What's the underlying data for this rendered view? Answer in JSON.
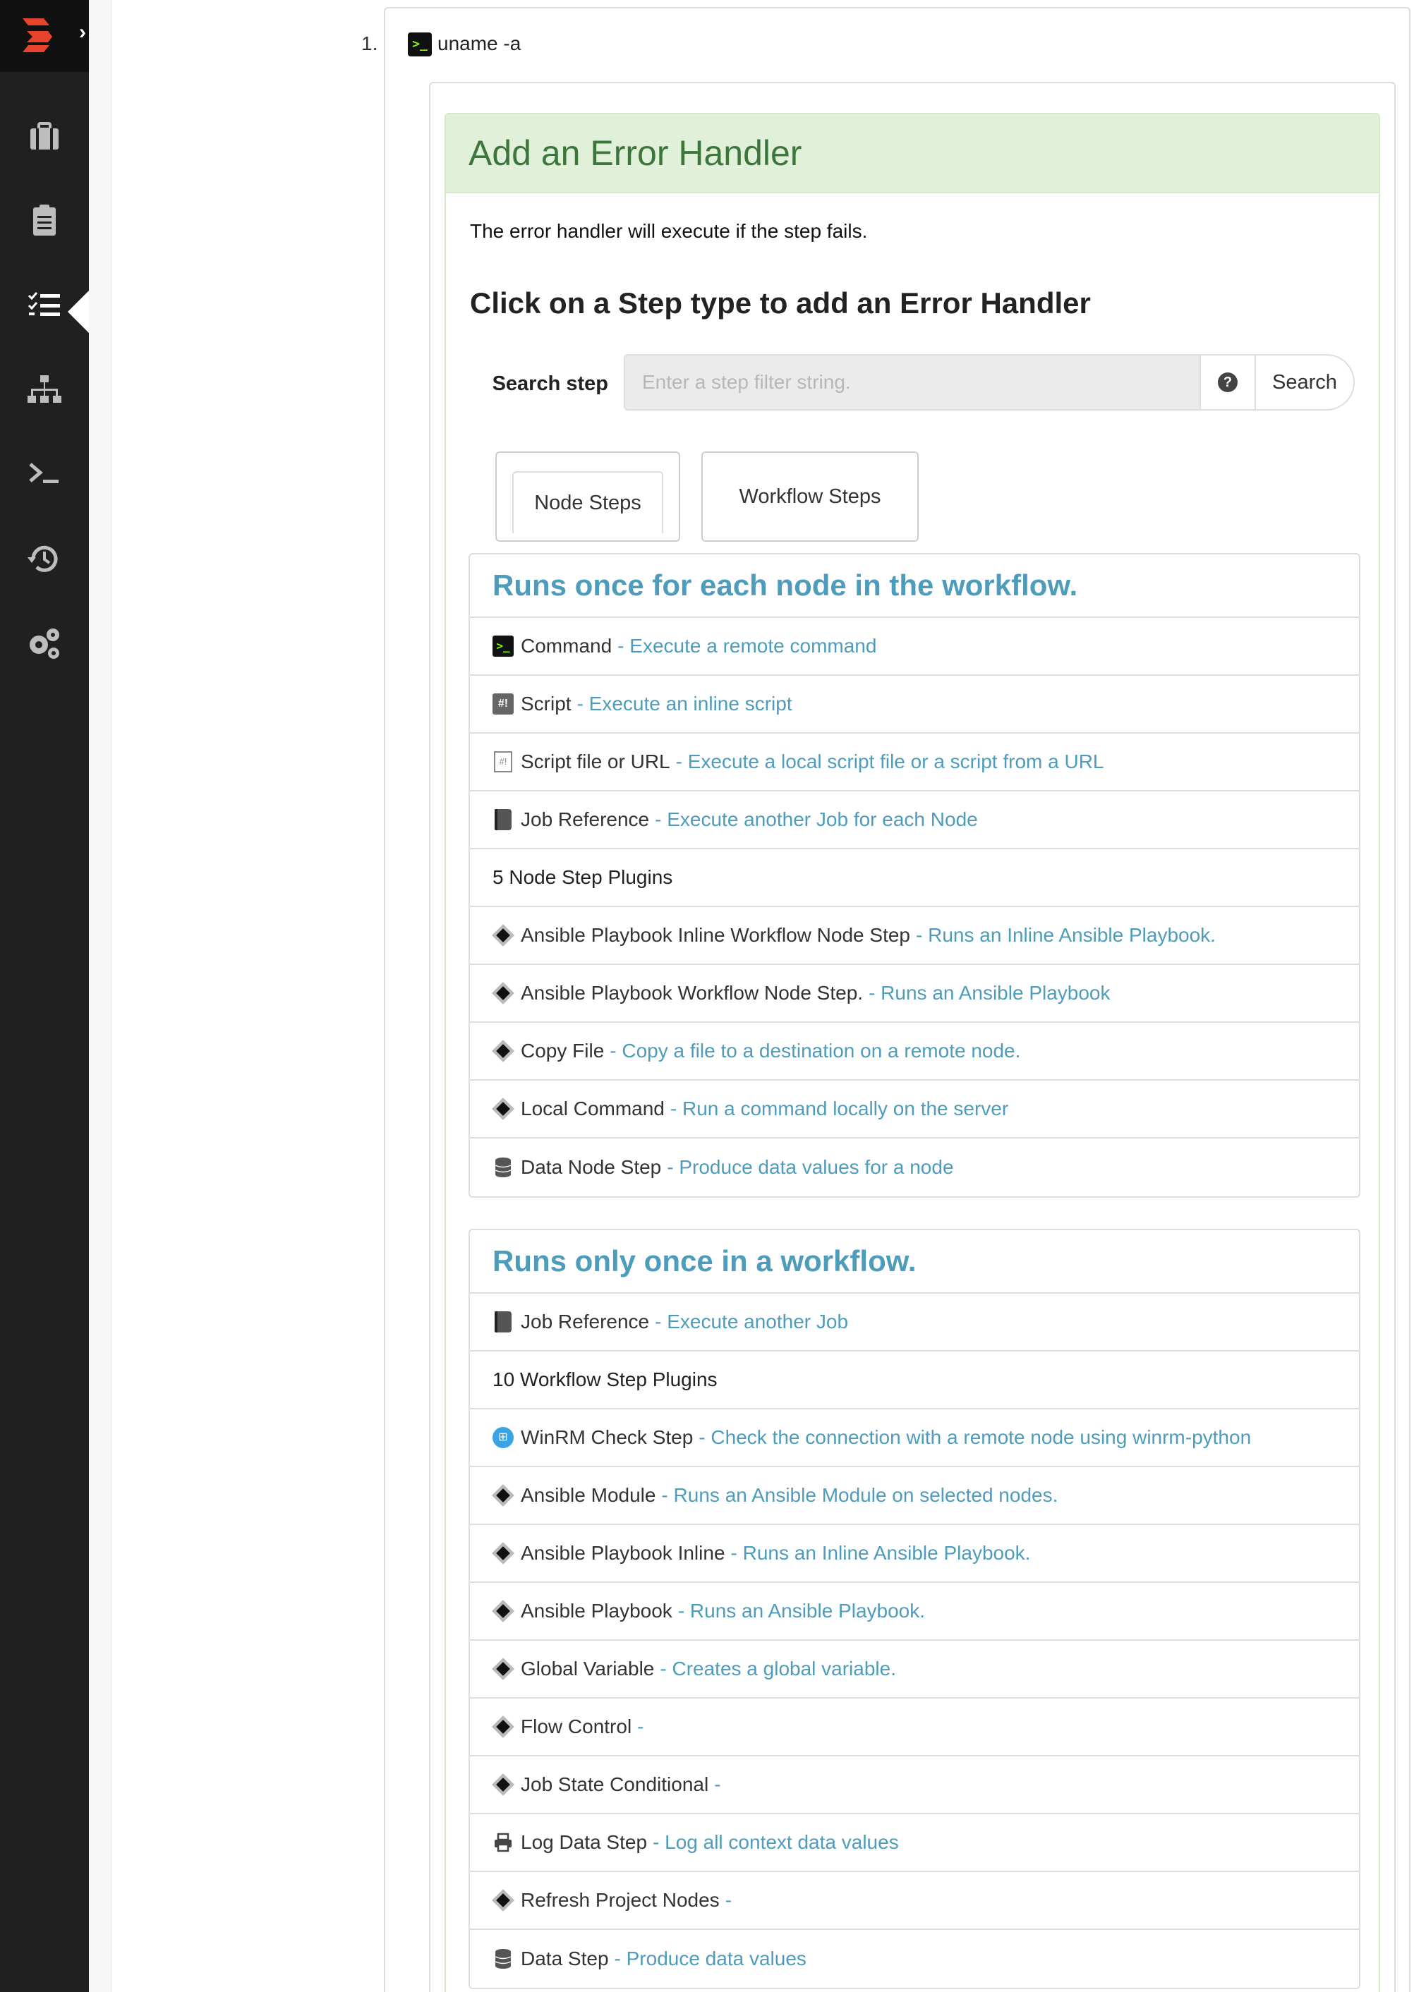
{
  "sidebar": {
    "nav": [
      {
        "icon": "briefcase-icon"
      },
      {
        "icon": "clipboard-list-icon"
      },
      {
        "icon": "tasks-list-icon"
      },
      {
        "icon": "sitemap-icon"
      },
      {
        "icon": "terminal-icon"
      },
      {
        "icon": "history-icon"
      },
      {
        "icon": "gears-icon"
      }
    ],
    "active_index": 2
  },
  "step": {
    "number": "1.",
    "title": "uname -a"
  },
  "panel": {
    "heading": "Add an Error Handler",
    "help": "The error handler will execute if the step fails.",
    "instruction": "Click on a Step type to add an Error Handler"
  },
  "search": {
    "label": "Search step",
    "placeholder": "Enter a step filter string.",
    "button": "Search"
  },
  "tabs": {
    "node": "Node Steps",
    "workflow": "Workflow Steps"
  },
  "node_steps": {
    "heading": "Runs once for each node in the workflow.",
    "items": [
      {
        "icon": "command-icon",
        "name": "Command",
        "desc": "- Execute a remote command"
      },
      {
        "icon": "script-icon",
        "name": "Script",
        "desc": "- Execute an inline script"
      },
      {
        "icon": "script-file-icon",
        "name": "Script file or URL",
        "desc": "- Execute a local script file or a script from a URL"
      },
      {
        "icon": "book-icon",
        "name": "Job Reference",
        "desc": "- Execute another Job for each Node"
      }
    ],
    "plugins_label": "5 Node Step Plugins",
    "plugins": [
      {
        "icon": "diamond-icon",
        "name": "Ansible Playbook Inline Workflow Node Step",
        "desc": "- Runs an Inline Ansible Playbook."
      },
      {
        "icon": "diamond-icon",
        "name": "Ansible Playbook Workflow Node Step.",
        "desc": "- Runs an Ansible Playbook"
      },
      {
        "icon": "diamond-icon",
        "name": "Copy File",
        "desc": "- Copy a file to a destination on a remote node."
      },
      {
        "icon": "diamond-icon",
        "name": "Local Command",
        "desc": "- Run a command locally on the server"
      },
      {
        "icon": "database-icon",
        "name": "Data Node Step",
        "desc": "- Produce data values for a node"
      }
    ]
  },
  "workflow_steps": {
    "heading": "Runs only once in a workflow.",
    "items": [
      {
        "icon": "book-icon",
        "name": "Job Reference",
        "desc": "- Execute another Job"
      }
    ],
    "plugins_label": "10 Workflow Step Plugins",
    "plugins": [
      {
        "icon": "windows-icon",
        "name": "WinRM Check Step",
        "desc": "- Check the connection with a remote node using winrm-python"
      },
      {
        "icon": "diamond-icon",
        "name": "Ansible Module",
        "desc": "- Runs an Ansible Module on selected nodes."
      },
      {
        "icon": "diamond-icon",
        "name": "Ansible Playbook Inline",
        "desc": "- Runs an Inline Ansible Playbook."
      },
      {
        "icon": "diamond-icon",
        "name": "Ansible Playbook",
        "desc": "- Runs an Ansible Playbook."
      },
      {
        "icon": "diamond-icon",
        "name": "Global Variable",
        "desc": "- Creates a global variable."
      },
      {
        "icon": "diamond-icon",
        "name": "Flow Control",
        "desc": "-"
      },
      {
        "icon": "diamond-icon",
        "name": "Job State Conditional",
        "desc": "-"
      },
      {
        "icon": "printer-icon",
        "name": "Log Data Step",
        "desc": "- Log all context data values"
      },
      {
        "icon": "diamond-icon",
        "name": "Refresh Project Nodes",
        "desc": "-"
      },
      {
        "icon": "database-icon",
        "name": "Data Step",
        "desc": "- Produce data values"
      }
    ]
  },
  "colors": {
    "sidebar_bg": "#202020",
    "heading_green_bg": "#e1f0d8",
    "heading_green_text": "#3c763d",
    "link_blue": "#4e9cbb",
    "brand_red": "#e8432c"
  }
}
